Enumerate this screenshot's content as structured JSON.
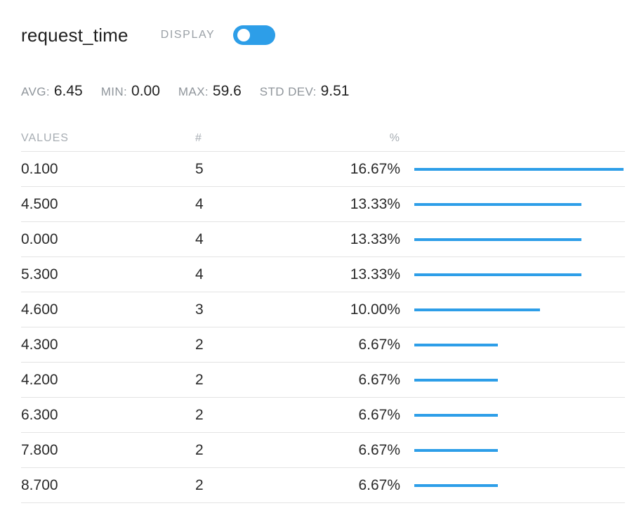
{
  "header": {
    "field_name": "request_time",
    "display_label": "DISPLAY",
    "display_toggle_on": true
  },
  "stats": {
    "avg_label": "AVG:",
    "avg_value": "6.45",
    "min_label": "MIN:",
    "min_value": "0.00",
    "max_label": "MAX:",
    "max_value": "59.6",
    "std_label": "STD DEV:",
    "std_value": "9.51"
  },
  "table": {
    "headers": {
      "values": "VALUES",
      "count": "#",
      "percent": "%"
    },
    "rows": [
      {
        "value": "0.100",
        "count": "5",
        "percent": "16.67%",
        "ratio": 1.0
      },
      {
        "value": "4.500",
        "count": "4",
        "percent": "13.33%",
        "ratio": 0.8
      },
      {
        "value": "0.000",
        "count": "4",
        "percent": "13.33%",
        "ratio": 0.8
      },
      {
        "value": "5.300",
        "count": "4",
        "percent": "13.33%",
        "ratio": 0.8
      },
      {
        "value": "4.600",
        "count": "3",
        "percent": "10.00%",
        "ratio": 0.6
      },
      {
        "value": "4.300",
        "count": "2",
        "percent": "6.67%",
        "ratio": 0.4
      },
      {
        "value": "4.200",
        "count": "2",
        "percent": "6.67%",
        "ratio": 0.4
      },
      {
        "value": "6.300",
        "count": "2",
        "percent": "6.67%",
        "ratio": 0.4
      },
      {
        "value": "7.800",
        "count": "2",
        "percent": "6.67%",
        "ratio": 0.4
      },
      {
        "value": "8.700",
        "count": "2",
        "percent": "6.67%",
        "ratio": 0.4
      }
    ]
  },
  "colors": {
    "accent": "#2d9ee8"
  }
}
